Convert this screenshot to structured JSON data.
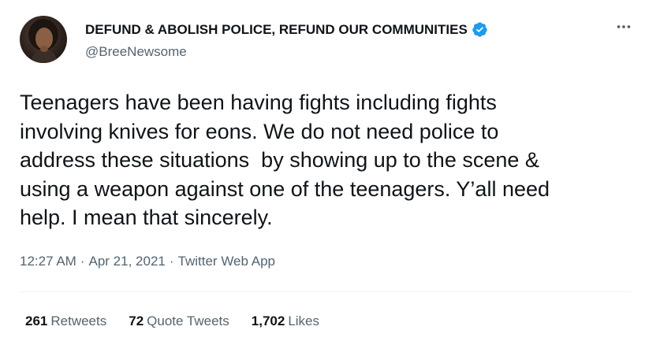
{
  "author": {
    "display_name": "DEFUND & ABOLISH POLICE, REFUND OUR COMMUNITIES",
    "handle": "@BreeNewsome",
    "verified": true
  },
  "tweet": {
    "text": "Teenagers have been having fights including fights\ninvolving knives for eons. We do not need police to\naddress these situations  by showing up to the scene &\nusing a weapon against one of the teenagers. Y’all need\nhelp. I mean that sincerely.",
    "time": "12:27 AM",
    "date": "Apr 21, 2021",
    "source": "Twitter Web App",
    "separator": "·"
  },
  "stats": {
    "retweets_count": "261",
    "retweets_label": "Retweets",
    "quotes_count": "72",
    "quotes_label": "Quote Tweets",
    "likes_count": "1,702",
    "likes_label": "Likes"
  },
  "icons": {
    "more": "more-horizontal-icon",
    "verified": "verified-badge-icon"
  },
  "colors": {
    "text_primary": "#0f1419",
    "text_secondary": "#536471",
    "verified_blue": "#1d9bf0",
    "divider": "#eff3f4"
  }
}
